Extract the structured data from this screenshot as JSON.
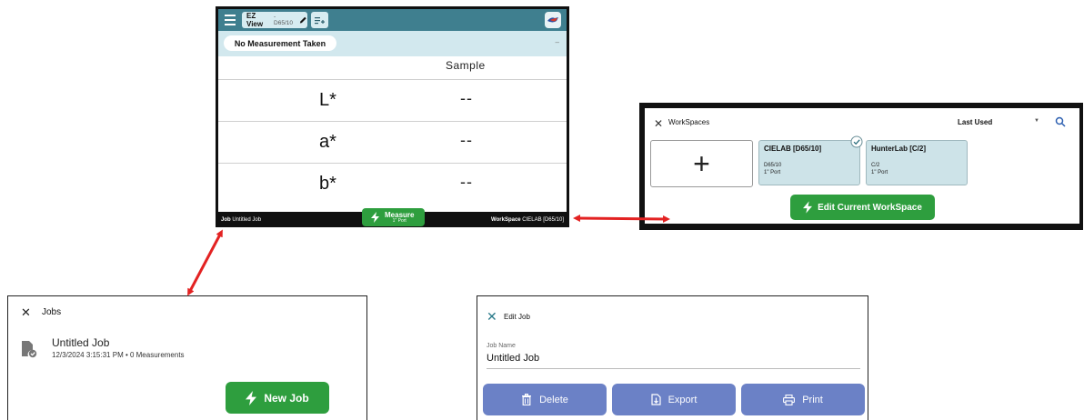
{
  "main": {
    "view_tab": "EZ View",
    "view_tab_sub": "- D65/10",
    "status": "No Measurement Taken",
    "status_dash": "–",
    "column_header": "Sample",
    "rows": [
      {
        "label": "L*",
        "value": "--"
      },
      {
        "label": "a*",
        "value": "--"
      },
      {
        "label": "b*",
        "value": "--"
      }
    ],
    "footer_job_label": "Job",
    "footer_job_value": "Untitled Job",
    "footer_ws_label": "WorkSpace",
    "footer_ws_value": "CIELAB [D65/10]",
    "measure_label": "Measure",
    "measure_sub": "1\" Port",
    "colors": {
      "header": "#3f7f8f",
      "accent_green": "#2e9e3e"
    }
  },
  "workspaces": {
    "title": "WorkSpaces",
    "sort_label": "Last Used",
    "add_symbol": "+",
    "cards": [
      {
        "name": "CIELAB [D65/10]",
        "illuminant": "D65/10",
        "port": "1\" Port",
        "selected": true
      },
      {
        "name": "HunterLab [C/2]",
        "illuminant": "C/2",
        "port": "1\" Port",
        "selected": false
      }
    ],
    "edit_button": "Edit Current WorkSpace"
  },
  "jobs": {
    "title": "Jobs",
    "items": [
      {
        "name": "Untitled Job",
        "meta": "12/3/2024 3:15:31 PM  •  0 Measurements"
      }
    ],
    "new_job_button": "New Job"
  },
  "edit_job": {
    "title": "Edit Job",
    "field_label": "Job Name",
    "field_value": "Untitled Job",
    "buttons": {
      "delete": "Delete",
      "export": "Export",
      "print": "Print"
    },
    "colors": {
      "button": "#6b81c6"
    }
  }
}
